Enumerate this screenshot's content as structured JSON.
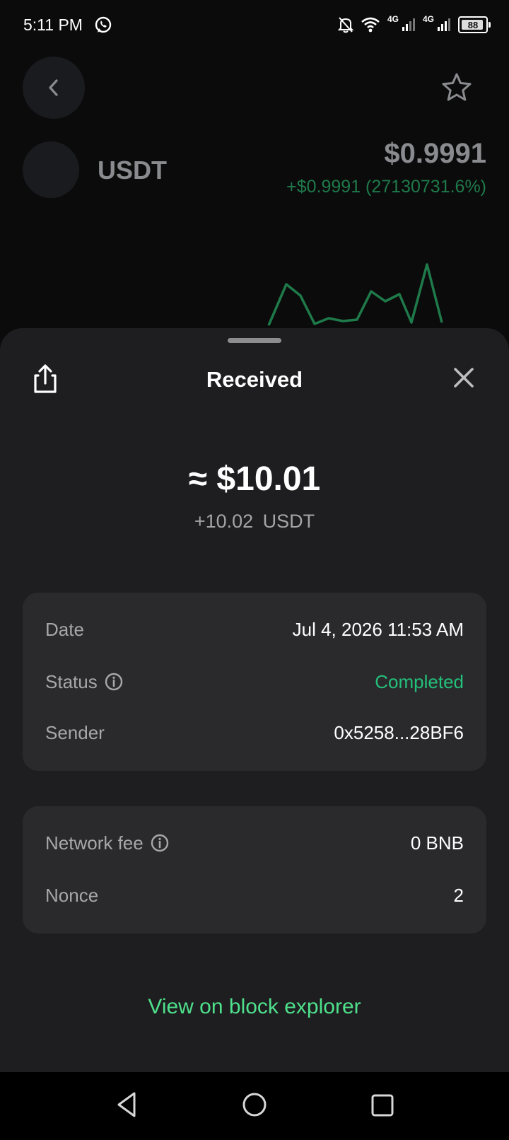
{
  "status_bar": {
    "time": "5:11 PM",
    "network_1": "4G",
    "network_2": "4G",
    "battery": "88"
  },
  "coin_header": {
    "symbol": "USDT",
    "price": "$0.9991",
    "change": "+$0.9991 (27130731.6%)"
  },
  "sheet": {
    "title": "Received",
    "amount_usd": "≈ $10.01",
    "amount_token": "+10.02  USDT",
    "details": {
      "date_label": "Date",
      "date_value": "Jul 4, 2026 11:53 AM",
      "status_label": "Status",
      "status_value": "Completed",
      "sender_label": "Sender",
      "sender_value": "0x5258...28BF6"
    },
    "fees": {
      "fee_label": "Network fee",
      "fee_value": "0 BNB",
      "nonce_label": "Nonce",
      "nonce_value": "2"
    },
    "explorer_link": "View on block explorer"
  },
  "colors": {
    "accent_green": "#4ee08c",
    "status_green": "#23c07a",
    "sheet_bg": "#1e1e20",
    "card_bg": "#2a2a2d"
  },
  "icons": {
    "back": "chevron-left-icon",
    "favorite": "star-icon",
    "share": "share-icon",
    "close": "close-icon",
    "info": "info-icon",
    "nav_back": "triangle-back-icon",
    "nav_home": "circle-home-icon",
    "nav_recent": "square-recents-icon"
  }
}
